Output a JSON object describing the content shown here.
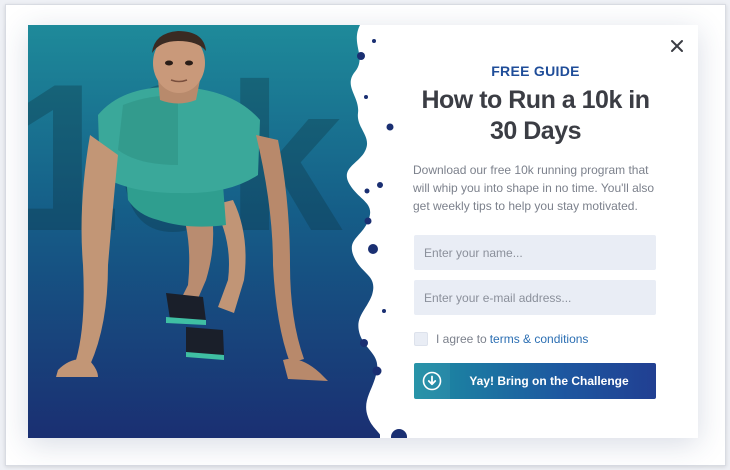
{
  "hero": {
    "background_text": "10k"
  },
  "popup": {
    "eyebrow": "FREE GUIDE",
    "title": "How to Run a 10k in 30 Days",
    "description": "Download our free 10k running program that will whip you into shape in no time. You'll also get weekly tips to help you stay motivated."
  },
  "form": {
    "name_placeholder": "Enter your name...",
    "email_placeholder": "Enter your e-mail address...",
    "agree_text": "I agree to",
    "terms_link": "terms & conditions",
    "cta_label": "Yay! Bring on the Challenge"
  },
  "icons": {
    "close": "close-icon",
    "download": "download-icon"
  },
  "colors": {
    "accent": "#1f4d99",
    "link": "#2c6fb3",
    "hero_top": "#1e8a9a",
    "hero_bottom": "#1a2f72",
    "input_bg": "#e9edf5"
  }
}
